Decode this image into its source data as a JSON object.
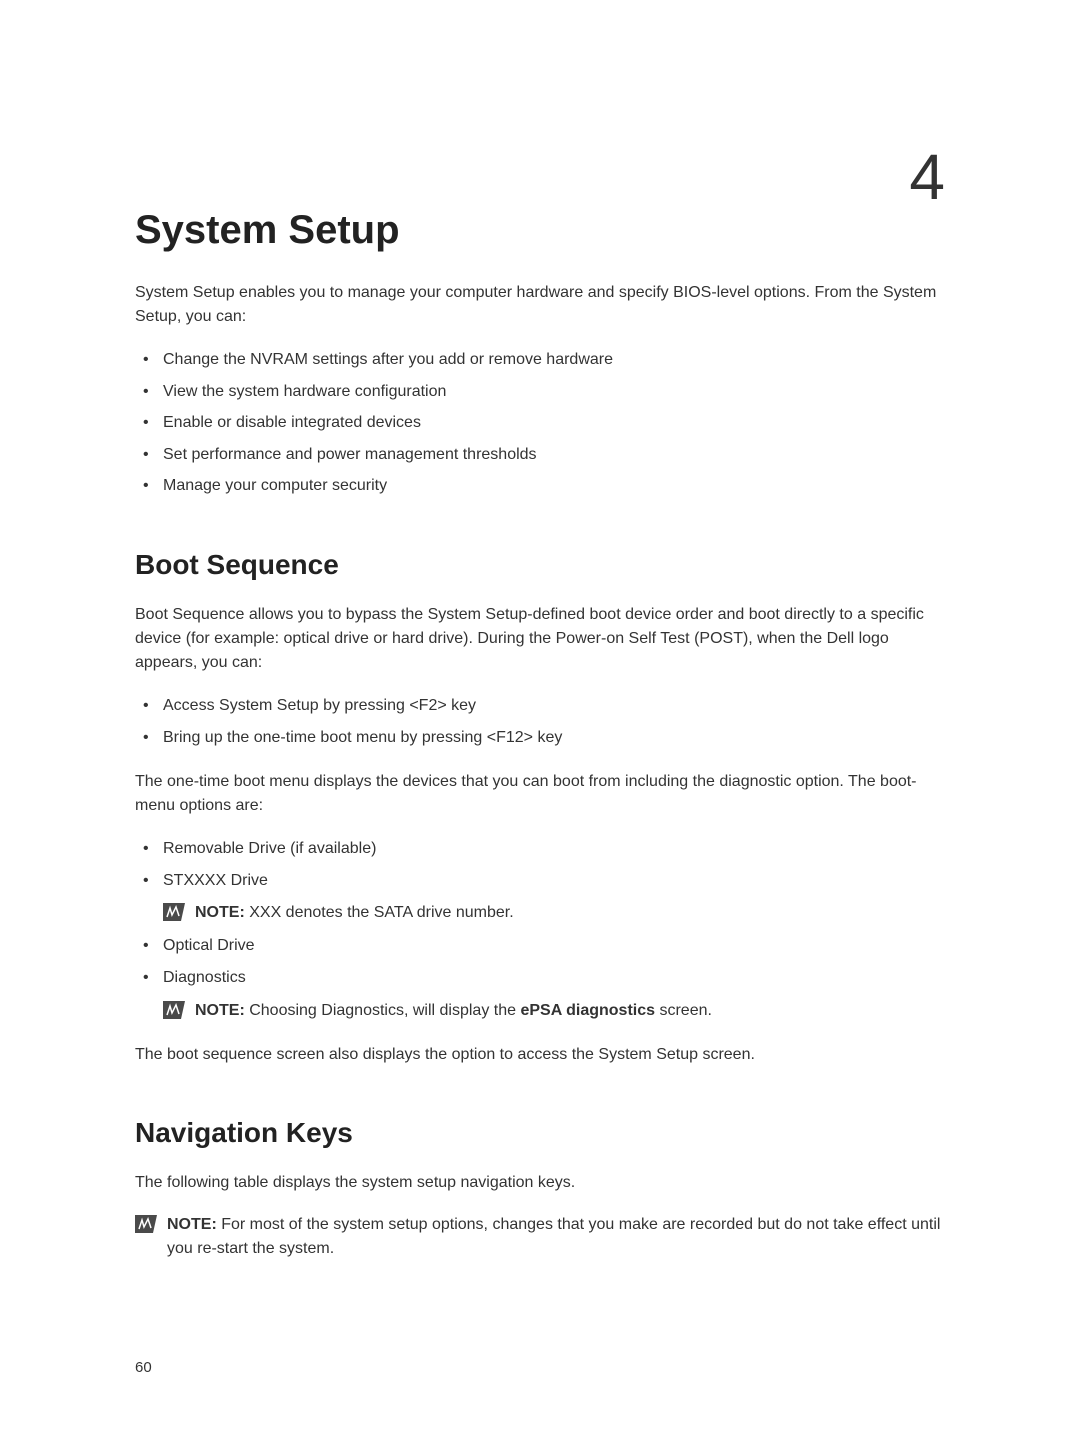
{
  "chapterNumber": "4",
  "title": "System Setup",
  "intro": "System Setup enables you to manage your computer hardware and specify BIOS-level options. From the System Setup, you can:",
  "introList": [
    "Change the NVRAM settings after you add or remove hardware",
    "View the system hardware configuration",
    "Enable or disable integrated devices",
    "Set performance and power management thresholds",
    "Manage your computer security"
  ],
  "bootSequence": {
    "heading": "Boot Sequence",
    "p1": "Boot Sequence allows you to bypass the System Setup‐defined boot device order and boot directly to a specific device (for example: optical drive or hard drive). During the Power-on Self Test (POST), when the Dell logo appears, you can:",
    "list1": [
      "Access System Setup by pressing <F2> key",
      "Bring up the one-time boot menu by pressing <F12> key"
    ],
    "p2": "The one-time boot menu displays the devices that you can boot from including the diagnostic option. The boot-menu options are:",
    "list2": {
      "item1": "Removable Drive (if available)",
      "item2": "STXXXX Drive",
      "note2_label": "NOTE: ",
      "note2_text": "XXX denotes the SATA drive number.",
      "item3": "Optical Drive",
      "item4": "Diagnostics",
      "note4_label": "NOTE: ",
      "note4_text_a": "Choosing Diagnostics, will display the ",
      "note4_bold": "ePSA diagnostics",
      "note4_text_b": " screen."
    },
    "p3": "The boot sequence screen also displays the option to access the System Setup screen."
  },
  "navKeys": {
    "heading": "Navigation Keys",
    "p1": "The following table displays the system setup navigation keys.",
    "note_label": "NOTE: ",
    "note_text": "For most of the system setup options, changes that you make are recorded but do not take effect until you re-start the system."
  },
  "pageNumber": "60"
}
